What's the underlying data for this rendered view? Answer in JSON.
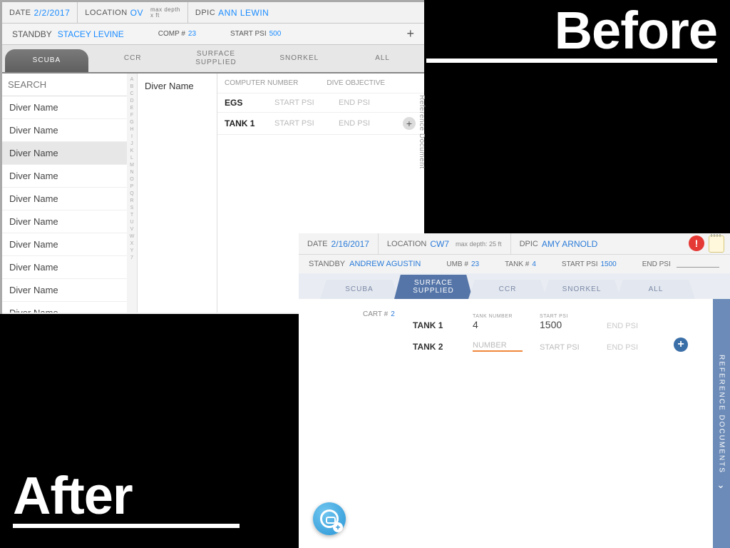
{
  "labels": {
    "before": "Before",
    "after": "After"
  },
  "before": {
    "header": {
      "date_label": "DATE",
      "date_value": "2/2/2017",
      "location_label": "LOCATION",
      "location_value": "OV",
      "depth_note_a": "max depth",
      "depth_note_b": "x ft",
      "dpic_label": "DPIC",
      "dpic_value": "ANN LEWIN"
    },
    "header2": {
      "standby_label": "STANDBY",
      "standby_value": "STACEY LEVINE",
      "comp_label": "COMP #",
      "comp_value": "23",
      "startpsi_label": "START PSI",
      "startpsi_value": "500",
      "plus": "+"
    },
    "tabs": [
      "SCUBA",
      "CCR",
      "SURFACE\nSUPPLIED",
      "SNORKEL",
      "ALL"
    ],
    "active_tab": 0,
    "search_placeholder": "SEARCH",
    "diver_rows": [
      "Diver Name",
      "Diver Name",
      "Diver Name",
      "Diver Name",
      "Diver Name",
      "Diver Name",
      "Diver Name",
      "Diver Name",
      "Diver Name",
      "Diver Name"
    ],
    "selected_row": 2,
    "index_letters": "ABCDEFGHIJKLMNOPQRSTUVWXY7",
    "center_title": "Diver Name",
    "detail_header": {
      "comp": "COMPUTER NUMBER",
      "obj": "DIVE OBJECTIVE"
    },
    "detail_lines": [
      {
        "b": "EGS",
        "c1": "START PSI",
        "c2": "END PSI",
        "add": false
      },
      {
        "b": "TANK 1",
        "c1": "START PSI",
        "c2": "END PSI",
        "add": true
      }
    ],
    "side_tab": "Reference Document"
  },
  "after": {
    "header": {
      "date_label": "DATE",
      "date_value": "2/16/2017",
      "location_label": "LOCATION",
      "location_value": "CW7",
      "depth_note": "max depth: 25 ft",
      "dpic_label": "DPIC",
      "dpic_value": "AMY ARNOLD"
    },
    "header2": {
      "standby_label": "STANDBY",
      "standby_value": "ANDREW AGUSTIN",
      "umb_label": "UMB #",
      "umb_value": "23",
      "tank_label": "TANK #",
      "tank_value": "4",
      "startpsi_label": "START PSI",
      "startpsi_value": "1500",
      "endpsi_label": "END PSI"
    },
    "tabs": [
      "SCUBA",
      "SURFACE\nSUPPLIED",
      "CCR",
      "SNORKEL",
      "ALL"
    ],
    "active_tab": 1,
    "cart_label": "CART #",
    "cart_value": "2",
    "rows": [
      {
        "b": "TANK 1",
        "f1_tiny": "TANK NUMBER",
        "f1_val": "4",
        "f2_tiny": "START PSI",
        "f2_val": "1500",
        "end": "END PSI",
        "add": false,
        "orange": false
      },
      {
        "b": "TANK 2",
        "f1_tiny": "",
        "f1_val": "NUMBER",
        "f2_tiny": "",
        "f2_val": "START PSI",
        "end": "END PSI",
        "add": true,
        "orange": true
      }
    ],
    "side_tab": "REFERENCE DOCUMENTS"
  }
}
